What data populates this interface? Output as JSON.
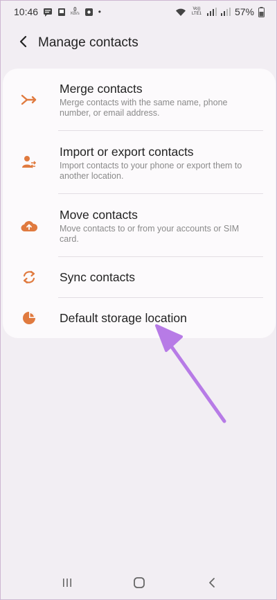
{
  "status_bar": {
    "time": "10:46",
    "speed_unit": "KB/s",
    "dot": "•",
    "volte_label": "Vo)) LTE1",
    "battery": "57%"
  },
  "header": {
    "title": "Manage contacts",
    "back_icon": "back-arrow-icon"
  },
  "items": [
    {
      "icon": "merge-icon",
      "title": "Merge contacts",
      "subtitle": "Merge contacts with the same name, phone number, or email address."
    },
    {
      "icon": "import-export-icon",
      "title": "Import or export contacts",
      "subtitle": "Import contacts to your phone or export them to another location."
    },
    {
      "icon": "cloud-upload-icon",
      "title": "Move contacts",
      "subtitle": "Move contacts to or from your accounts or SIM card."
    },
    {
      "icon": "sync-icon",
      "title": "Sync contacts"
    },
    {
      "icon": "storage-pie-icon",
      "title": "Default storage location"
    }
  ],
  "colors": {
    "accent": "#e07a3f",
    "annotation_arrow": "#b77be6",
    "background": "#f2eef3",
    "card": "#fcfafc"
  },
  "nav_bar": {
    "recents_icon": "recents-icon",
    "home_icon": "home-icon",
    "back_icon": "back-icon"
  }
}
